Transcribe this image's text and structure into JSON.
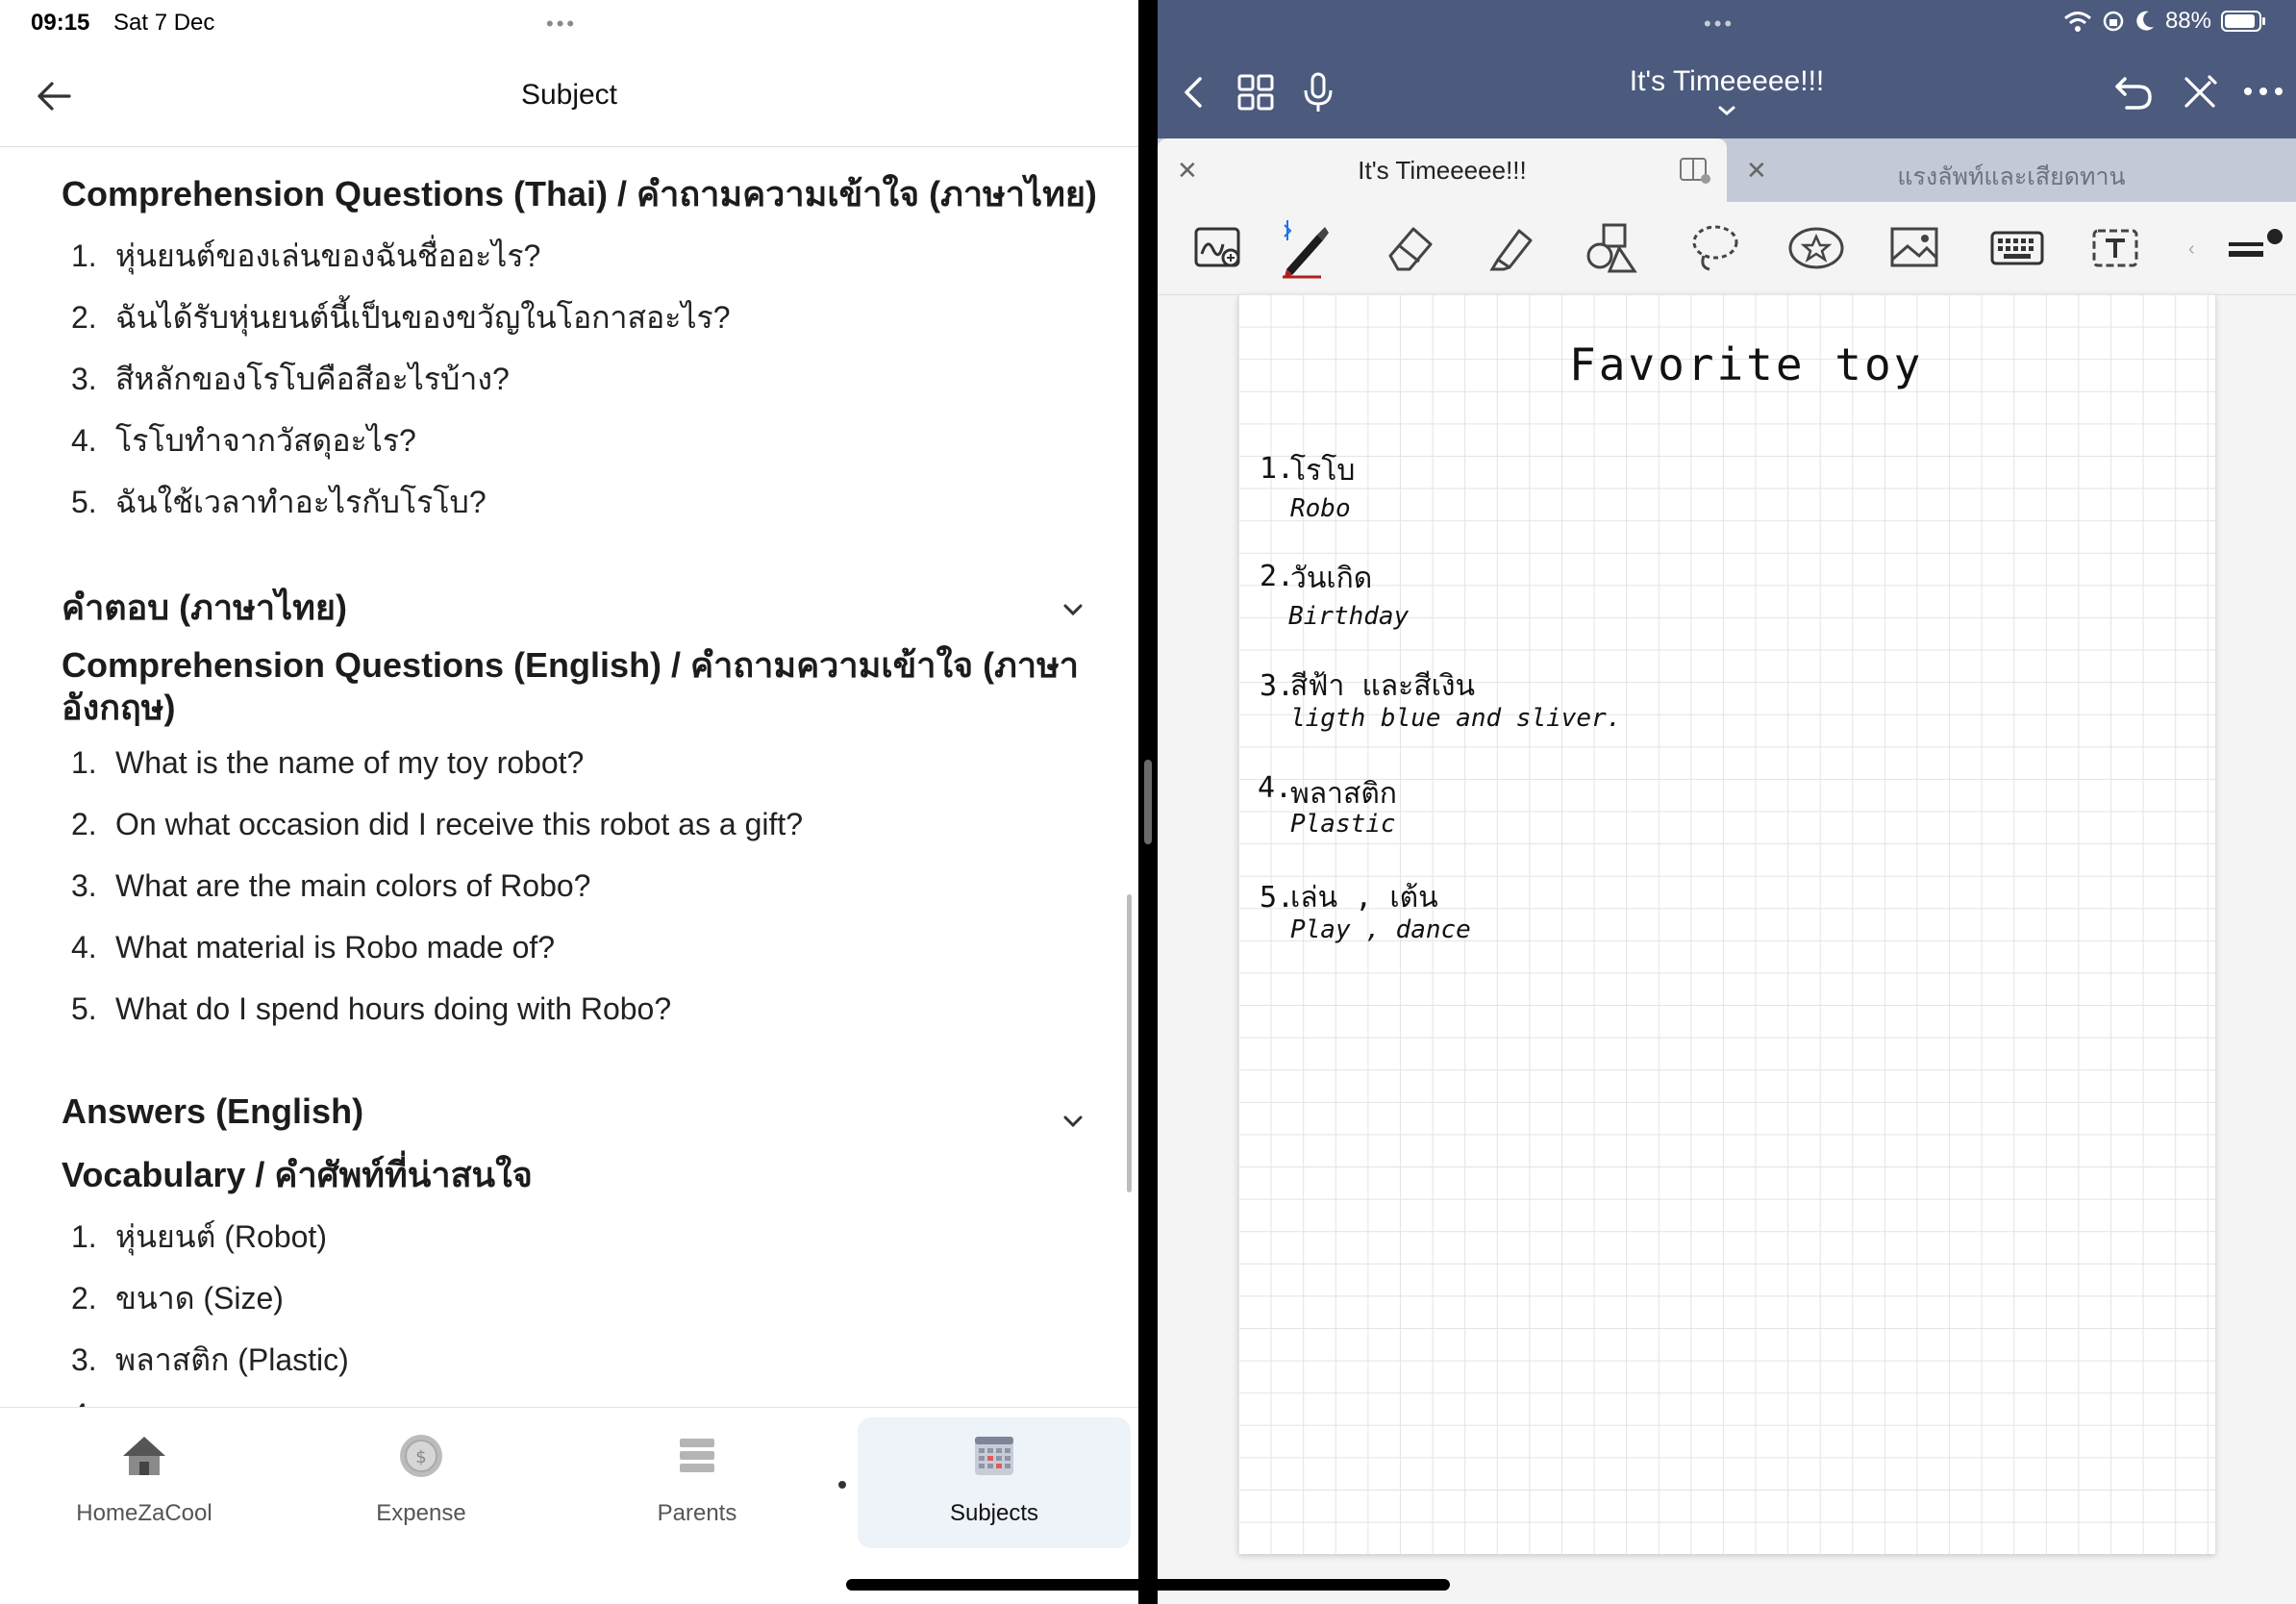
{
  "left": {
    "status": {
      "time": "09:15",
      "date": "Sat 7 Dec"
    },
    "title": "Subject",
    "sections": {
      "q_thai_heading": "Comprehension Questions (Thai) / คำถามความเข้าใจ (ภาษาไทย)",
      "q_thai": [
        "หุ่นยนต์ของเล่นของฉันชื่ออะไร?",
        "ฉันได้รับหุ่นยนต์นี้เป็นของขวัญในโอกาสอะไร?",
        "สีหลักของโรโบคือสีอะไรบ้าง?",
        "โรโบทำจากวัสดุอะไร?",
        "ฉันใช้เวลาทำอะไรกับโรโบ?"
      ],
      "answers_thai_heading": "คำตอบ (ภาษาไทย)",
      "q_en_heading_line1": "Comprehension Questions (English) / คำถามความเข้าใจ (ภาษา",
      "q_en_heading_line2": "อังกฤษ)",
      "q_en": [
        "What is the name of my toy robot?",
        "On what occasion did I receive this robot as a gift?",
        "What are the main colors of Robo?",
        "What material is Robo made of?",
        "What do I spend hours doing with Robo?"
      ],
      "answers_en_heading": "Answers (English)",
      "vocab_heading": "Vocabulary / คำศัพท์ที่น่าสนใจ",
      "vocab": [
        "หุ่นยนต์ (Robot)",
        "ขนาด (Size)",
        "พลาสติก (Plastic)"
      ]
    },
    "nav": [
      {
        "label": "HomeZaCool",
        "icon": "home-icon"
      },
      {
        "label": "Expense",
        "icon": "coin-icon"
      },
      {
        "label": "Parents",
        "icon": "list-icon"
      },
      {
        "label": "Subjects",
        "icon": "grid-icon",
        "active": true
      }
    ]
  },
  "right": {
    "status": {
      "battery": "88%"
    },
    "title": "It's Timeeeee!!!",
    "tabs": [
      {
        "label": "It's Timeeeee!!!",
        "active": true
      },
      {
        "label": "แรงลัพท์และเสียดทาน",
        "active": false
      }
    ],
    "note": {
      "title": "Favorite toy",
      "items": [
        {
          "num": "1.",
          "th": "โรโบ",
          "en": "Robo"
        },
        {
          "num": "2.",
          "th": "วันเกิด",
          "en": "Birthday"
        },
        {
          "num": "3.",
          "th": "สีฟ้า และสีเงิน",
          "en": "ligth blue and sliver."
        },
        {
          "num": "4.",
          "th": "พลาสติก",
          "en": "Plastic"
        },
        {
          "num": "5.",
          "th": "เล่น , เต้น",
          "en": "Play , dance"
        }
      ]
    },
    "accent": "#4c5a7d"
  }
}
